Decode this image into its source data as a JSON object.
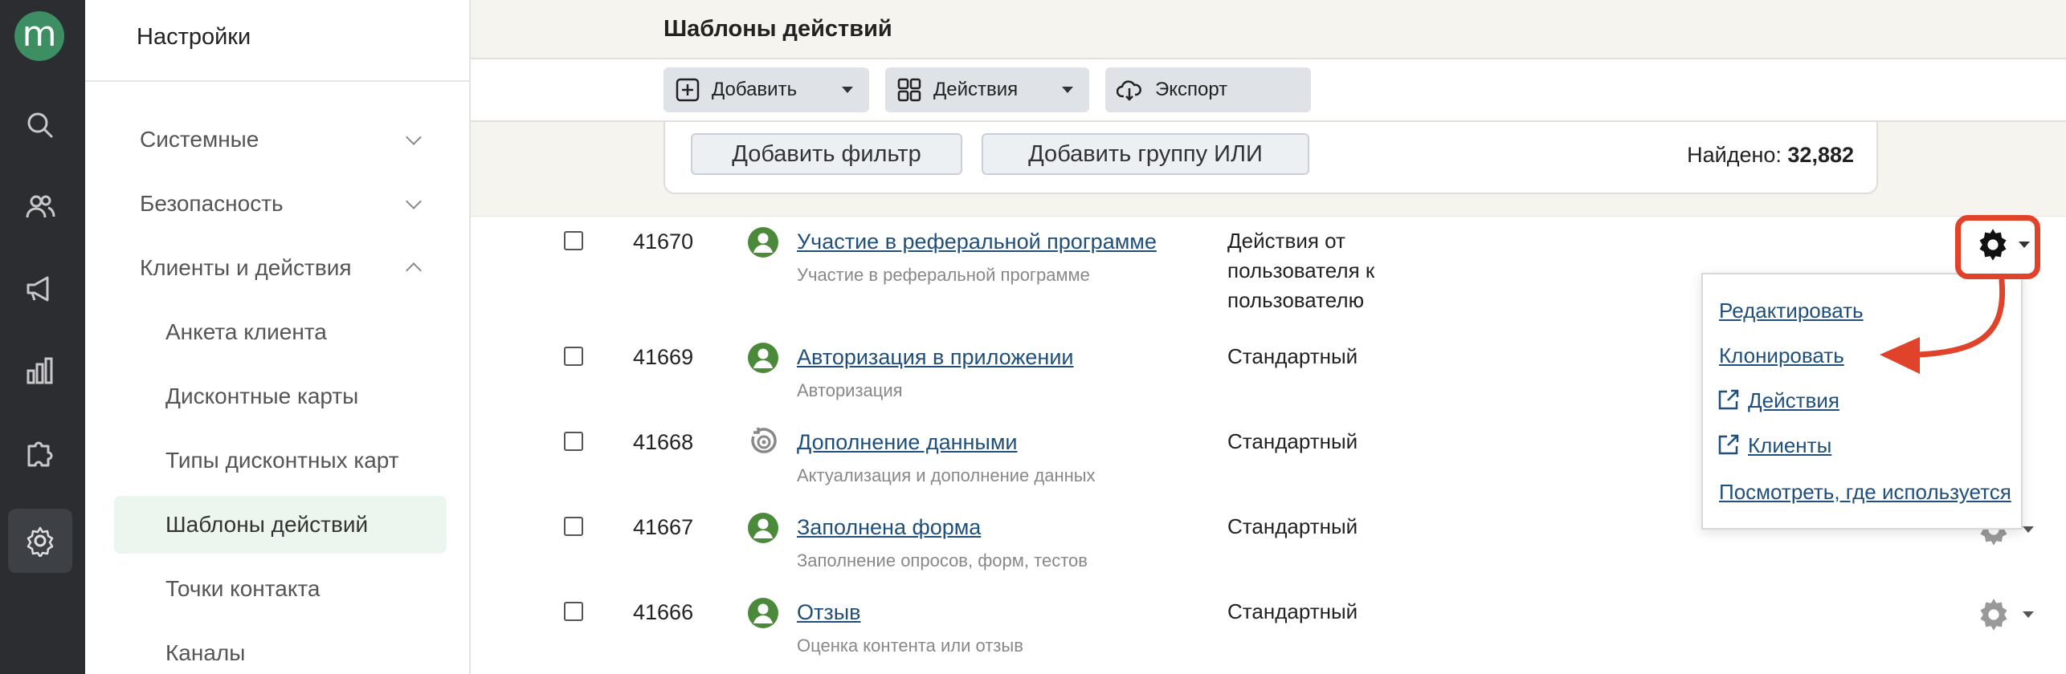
{
  "app": {
    "logo_letter": "m",
    "accent": "#3d8f63"
  },
  "rail": {
    "items": [
      {
        "icon": "search-icon"
      },
      {
        "icon": "users-icon"
      },
      {
        "icon": "megaphone-icon"
      },
      {
        "icon": "bar-chart-icon"
      },
      {
        "icon": "puzzle-icon"
      },
      {
        "icon": "gear-icon",
        "active": true
      }
    ]
  },
  "sidebar": {
    "title": "Настройки",
    "sections": [
      {
        "label": "Системные",
        "expanded": false
      },
      {
        "label": "Безопасность",
        "expanded": false
      },
      {
        "label": "Клиенты и действия",
        "expanded": true
      }
    ],
    "subitems": [
      {
        "label": "Анкета клиента"
      },
      {
        "label": "Дисконтные карты"
      },
      {
        "label": "Типы дисконтных карт"
      },
      {
        "label": "Шаблоны действий",
        "active": true
      },
      {
        "label": "Точки контакта"
      },
      {
        "label": "Каналы"
      }
    ]
  },
  "header": {
    "title": "Шаблоны действий"
  },
  "toolbar": {
    "add_label": "Добавить",
    "actions_label": "Действия",
    "export_label": "Экспорт"
  },
  "filters": {
    "add_filter_label": "Добавить фильтр",
    "add_group_label": "Добавить группу ИЛИ",
    "found_label": "Найдено:",
    "found_count": "32,882"
  },
  "rows": [
    {
      "id": "41670",
      "name": "Участие в реферальной программе",
      "sub": "Участие в реферальной программе",
      "type": [
        "Действия от",
        "пользователя к",
        "пользователю"
      ],
      "icon": "user-circle-icon"
    },
    {
      "id": "41669",
      "name": "Авторизация в приложении",
      "sub": "Авторизация",
      "type": [
        "Стандартный"
      ],
      "icon": "user-circle-icon"
    },
    {
      "id": "41668",
      "name": "Дополнение данными",
      "sub": "Актуализация и дополнение данных",
      "type": [
        "Стандартный"
      ],
      "icon": "refresh-target-icon"
    },
    {
      "id": "41667",
      "name": "Заполнена форма",
      "sub": "Заполнение опросов, форм, тестов",
      "type": [
        "Стандартный"
      ],
      "icon": "user-circle-icon"
    },
    {
      "id": "41666",
      "name": "Отзыв",
      "sub": "Оценка контента или отзыв",
      "type": [
        "Стандартный"
      ],
      "icon": "user-circle-icon"
    }
  ],
  "menu": {
    "items": [
      {
        "label": "Редактировать",
        "external": false
      },
      {
        "label": "Клонировать",
        "external": false
      },
      {
        "label": "Действия",
        "external": true
      },
      {
        "label": "Клиенты",
        "external": true
      },
      {
        "label": "Посмотреть, где используется",
        "external": false
      }
    ]
  },
  "colors": {
    "highlight": "#e0432a",
    "link": "#1f4f7a",
    "active_bg": "#edf6ee"
  }
}
